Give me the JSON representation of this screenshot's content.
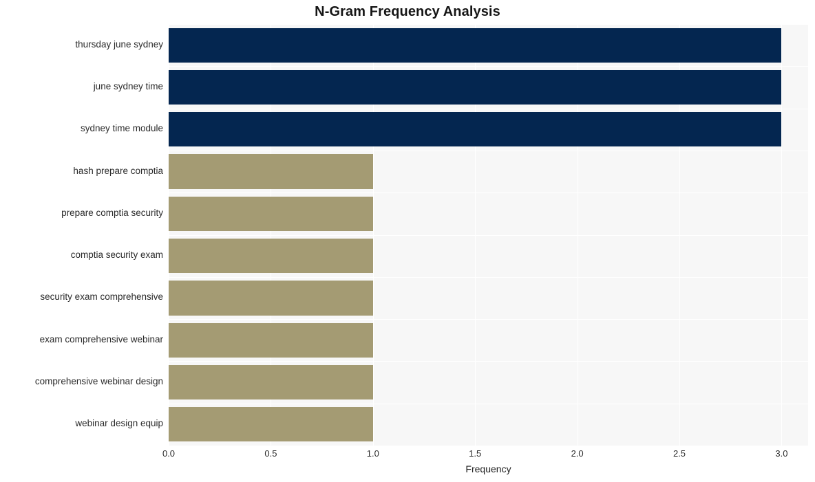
{
  "chart_data": {
    "type": "bar",
    "orientation": "horizontal",
    "title": "N-Gram Frequency Analysis",
    "xlabel": "Frequency",
    "ylabel": "",
    "xlim": [
      0,
      3.13
    ],
    "xticks": [
      "0.0",
      "0.5",
      "1.0",
      "1.5",
      "2.0",
      "2.5",
      "3.0"
    ],
    "xtick_values": [
      0,
      0.5,
      1,
      1.5,
      2,
      2.5,
      3
    ],
    "grid": true,
    "legend": "none",
    "categories": [
      "thursday june sydney",
      "june sydney time",
      "sydney time module",
      "hash prepare comptia",
      "prepare comptia security",
      "comptia security exam",
      "security exam comprehensive",
      "exam comprehensive webinar",
      "comprehensive webinar design",
      "webinar design equip"
    ],
    "values": [
      3,
      3,
      3,
      1,
      1,
      1,
      1,
      1,
      1,
      1
    ],
    "bar_colors": [
      "#042650",
      "#042650",
      "#042650",
      "#a49b73",
      "#a49b73",
      "#a49b73",
      "#a49b73",
      "#a49b73",
      "#a49b73",
      "#a49b73"
    ]
  },
  "style": {
    "plot_background": "#f7f7f7",
    "figure_background": "#ffffff",
    "gridline_color": "#ffffff",
    "title_color": "#151515",
    "tick_color": "#2a2a2a",
    "color_high": "#042650",
    "color_low": "#a49b73"
  }
}
